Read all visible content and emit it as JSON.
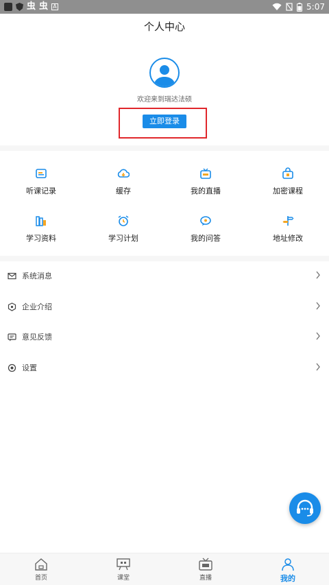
{
  "status_bar": {
    "time": "5:07",
    "icons": [
      "app-icon",
      "shield-icon",
      "bug-icon",
      "bug-icon",
      "a-icon",
      "wifi-icon",
      "no-sim-icon",
      "battery-icon"
    ]
  },
  "header": {
    "title": "个人中心"
  },
  "profile": {
    "welcome": "欢迎来到瑞达法硕",
    "login_label": "立即登录"
  },
  "grid": [
    {
      "label": "听课记录",
      "icon": "record-icon"
    },
    {
      "label": "缓存",
      "icon": "cloud-download-icon"
    },
    {
      "label": "我的直播",
      "icon": "live-tv-icon"
    },
    {
      "label": "加密课程",
      "icon": "lock-bag-icon"
    },
    {
      "label": "学习资料",
      "icon": "books-icon"
    },
    {
      "label": "学习计划",
      "icon": "alarm-icon"
    },
    {
      "label": "我的问答",
      "icon": "qa-icon"
    },
    {
      "label": "地址修改",
      "icon": "signpost-icon"
    }
  ],
  "menu": [
    {
      "label": "系统消息",
      "icon": "mail-icon"
    },
    {
      "label": "企业介绍",
      "icon": "company-icon"
    },
    {
      "label": "意见反馈",
      "icon": "feedback-icon"
    },
    {
      "label": "设置",
      "icon": "settings-icon"
    }
  ],
  "tabs": [
    {
      "label": "首页",
      "icon": "home-icon"
    },
    {
      "label": "课堂",
      "icon": "classroom-icon"
    },
    {
      "label": "直播",
      "icon": "tv-icon"
    },
    {
      "label": "我的",
      "icon": "profile-icon",
      "active": true
    }
  ],
  "colors": {
    "accent": "#1a8ce8",
    "highlight_frame": "#e0262b",
    "icon_accent": "#f5a623"
  }
}
